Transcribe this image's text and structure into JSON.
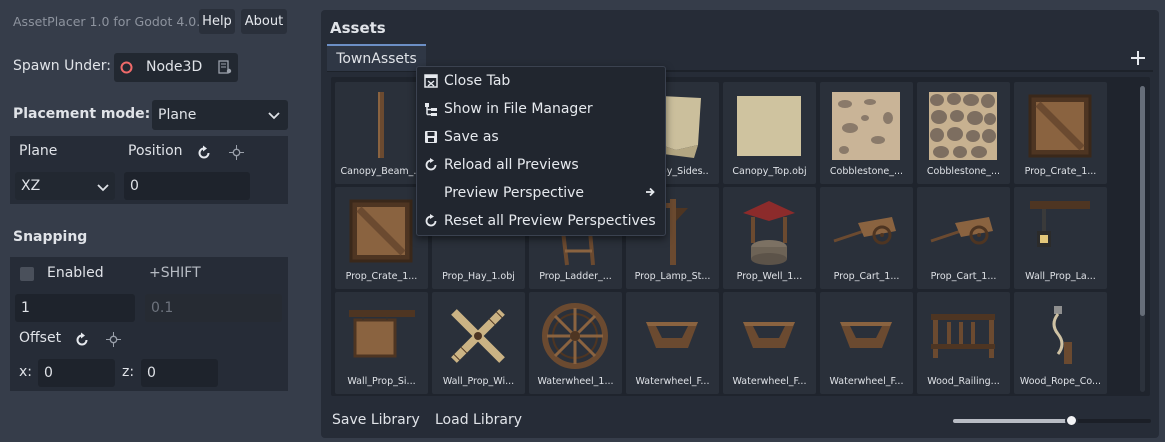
{
  "header": {
    "app_title": "AssetPlacer 1.0 for Godot 4.0.",
    "help_label": "Help",
    "about_label": "About"
  },
  "spawn": {
    "label": "Spawn Under:",
    "node_value": "Node3D"
  },
  "placement": {
    "label": "Placement mode:",
    "selected": "Plane",
    "plane_label": "Plane",
    "position_label": "Position",
    "axis_selected": "XZ",
    "position_value": "0"
  },
  "snapping": {
    "title": "Snapping",
    "enabled_label": "Enabled",
    "enabled_checked": false,
    "shift_label": "+SHIFT",
    "step_value": "1",
    "shift_step_placeholder": "0.1",
    "offset_label": "Offset",
    "x_label": "x:",
    "x_value": "0",
    "z_label": "z:",
    "z_value": "0"
  },
  "assets": {
    "title": "Assets",
    "tabs": [
      {
        "label": "TownAssets"
      }
    ],
    "add_tab_label": "+",
    "tiles": [
      {
        "caption": "Canopy_Beam_...",
        "icon": "beam"
      },
      {
        "caption": "",
        "icon": "none"
      },
      {
        "caption": "",
        "icon": "none"
      },
      {
        "caption": "Canopy_Sides..",
        "icon": "cloth"
      },
      {
        "caption": "Canopy_Top.obj",
        "icon": "cloth-flat"
      },
      {
        "caption": "Cobblestone_...",
        "icon": "cobble-sparse"
      },
      {
        "caption": "Cobblestone_...",
        "icon": "cobble-dense"
      },
      {
        "caption": "Prop_Crate_1...",
        "icon": "crate"
      },
      {
        "caption": "Prop_Crate_1...",
        "icon": "crate"
      },
      {
        "caption": "Prop_Hay_1.obj",
        "icon": "hay"
      },
      {
        "caption": "Prop_Ladder_...",
        "icon": "ladder"
      },
      {
        "caption": "Prop_Lamp_St...",
        "icon": "lamp-stand"
      },
      {
        "caption": "Prop_Well_1...",
        "icon": "well"
      },
      {
        "caption": "Prop_Cart_1...",
        "icon": "cart"
      },
      {
        "caption": "Prop_Cart_1...",
        "icon": "cart"
      },
      {
        "caption": "Wall_Prop_La...",
        "icon": "wall-lamp"
      },
      {
        "caption": "Wall_Prop_Si...",
        "icon": "sign"
      },
      {
        "caption": "Wall_Prop_Wi...",
        "icon": "windmill"
      },
      {
        "caption": "Waterwheel_1...",
        "icon": "wheel"
      },
      {
        "caption": "Waterwheel_F...",
        "icon": "trough"
      },
      {
        "caption": "Waterwheel_F...",
        "icon": "trough"
      },
      {
        "caption": "Waterwheel_F...",
        "icon": "trough"
      },
      {
        "caption": "Wood_Railing...",
        "icon": "railing"
      },
      {
        "caption": "Wood_Rope_Co...",
        "icon": "rope"
      }
    ],
    "save_library_label": "Save Library",
    "load_library_label": "Load Library",
    "thumbnail_size": 0.6
  },
  "context_menu": {
    "items": [
      {
        "label": "Close Tab",
        "icon": "close-tab-icon"
      },
      {
        "label": "Show in File Manager",
        "icon": "file-manager-icon"
      },
      {
        "label": "Save as",
        "icon": "save-icon"
      },
      {
        "label": "Reload all Previews",
        "icon": "reload-icon"
      },
      {
        "label": "Preview Perspective",
        "icon": "none",
        "submenu": true
      },
      {
        "label": "Reset all Preview Perspectives",
        "icon": "reload-icon"
      }
    ]
  },
  "colors": {
    "background": "#363d4a",
    "panel": "#262c37",
    "accent": "#6c8fc5",
    "node_icon": "#f06a6a"
  }
}
